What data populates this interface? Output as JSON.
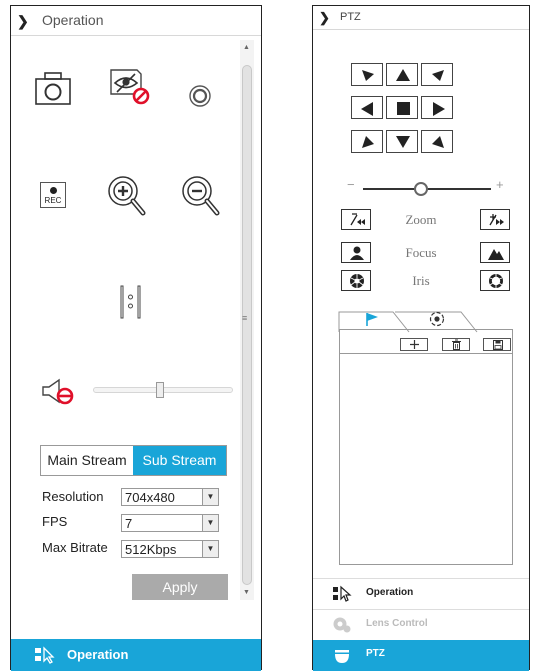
{
  "left_panel": {
    "header_title": "Operation",
    "stream_tabs": [
      "Main Stream",
      "Sub Stream"
    ],
    "active_stream": "Sub Stream",
    "fields": [
      {
        "label": "Resolution",
        "value": "704x480"
      },
      {
        "label": "FPS",
        "value": "7"
      },
      {
        "label": "Max Bitrate",
        "value": "512Kbps"
      }
    ],
    "apply_label": "Apply",
    "rec_label": "REC",
    "volume_level": 0.48,
    "footer_label": "Operation"
  },
  "right_panel": {
    "header_title": "PTZ",
    "speed_level": 0.45,
    "lens_rows": [
      "Zoom",
      "Focus",
      "Iris"
    ],
    "nav_items": [
      {
        "label": "Operation",
        "state": "normal"
      },
      {
        "label": "Lens Control",
        "state": "disabled"
      },
      {
        "label": "PTZ",
        "state": "active"
      }
    ]
  },
  "colors": {
    "accent": "#19a5d8",
    "warning_red": "#e0102a",
    "disabled_button": "#aaaaaa"
  }
}
